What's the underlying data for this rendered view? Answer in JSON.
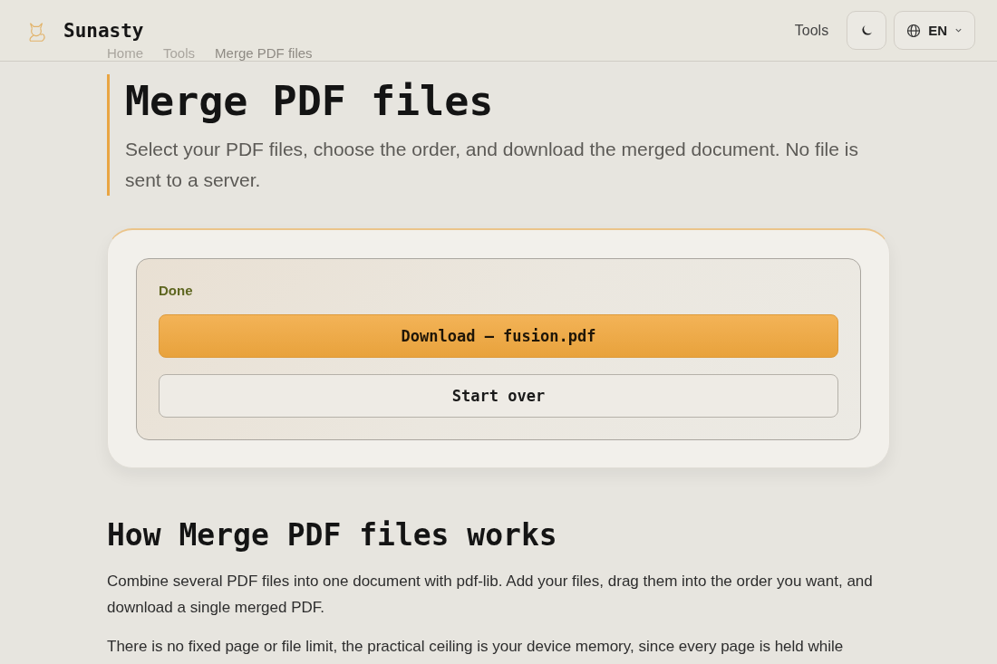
{
  "header": {
    "brand": "Sunasty",
    "nav_link": "Tools",
    "language": "EN"
  },
  "breadcrumb": [
    "Home",
    "Tools",
    "Merge PDF files"
  ],
  "title": "Merge PDF files",
  "subtitle": "Select your PDF files, choose the order, and download the merged document. No file is sent to a server.",
  "result": {
    "status": "Done",
    "download_button": "Download — fusion.pdf",
    "reset_button": "Start over"
  },
  "section": {
    "heading": "How Merge PDF files works",
    "paragraphs": [
      "Combine several PDF files into one document with pdf-lib. Add your files, drag them into the order you want, and download a single merged PDF.",
      "There is no fixed page or file limit, the practical ceiling is your device memory, since every page is held while"
    ]
  }
}
